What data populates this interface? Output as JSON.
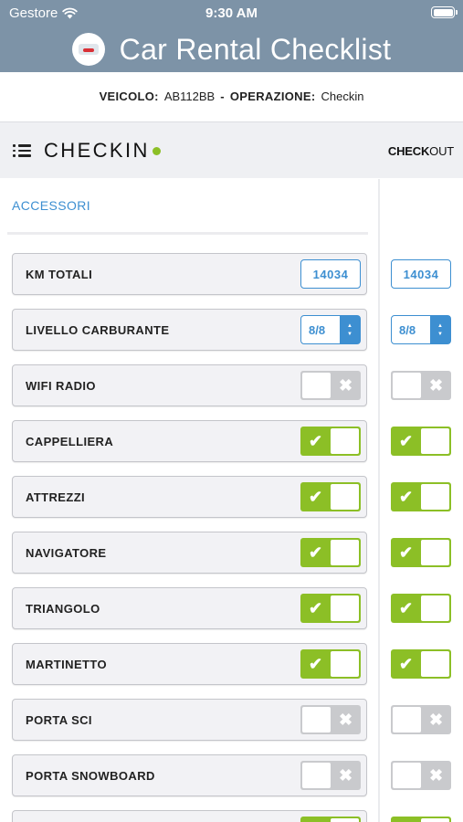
{
  "status_bar": {
    "carrier": "Gestore",
    "time": "9:30 AM"
  },
  "app": {
    "title": "Car Rental Checklist"
  },
  "info": {
    "vehicle_label": "VEICOLO:",
    "vehicle_value": "AB112BB",
    "separator": "-",
    "operation_label": "OPERAZIONE:",
    "operation_value": "Checkin"
  },
  "tabs": {
    "checkin": "CHECKIN",
    "checkout_bold": "CHECK",
    "checkout_rest": "OUT"
  },
  "section": {
    "title": "ACCESSORI"
  },
  "items": [
    {
      "label": "KM TOTALI",
      "type": "number",
      "checkin": "14034",
      "checkout": "14034"
    },
    {
      "label": "LIVELLO CARBURANTE",
      "type": "select",
      "checkin": "8/8",
      "checkout": "8/8"
    },
    {
      "label": "WIFI RADIO",
      "type": "toggle",
      "checkin": false,
      "checkout": false
    },
    {
      "label": "CAPPELLIERA",
      "type": "toggle",
      "checkin": true,
      "checkout": true
    },
    {
      "label": "ATTREZZI",
      "type": "toggle",
      "checkin": true,
      "checkout": true
    },
    {
      "label": "NAVIGATORE",
      "type": "toggle",
      "checkin": true,
      "checkout": true
    },
    {
      "label": "TRIANGOLO",
      "type": "toggle",
      "checkin": true,
      "checkout": true
    },
    {
      "label": "MARTINETTO",
      "type": "toggle",
      "checkin": true,
      "checkout": true
    },
    {
      "label": "PORTA SCI",
      "type": "toggle",
      "checkin": false,
      "checkout": false
    },
    {
      "label": "PORTA SNOWBOARD",
      "type": "toggle",
      "checkin": false,
      "checkout": false
    },
    {
      "label": "",
      "type": "toggle",
      "checkin": true,
      "checkout": true
    }
  ],
  "colors": {
    "header": "#7d93a7",
    "accent_blue": "#3d8fd1",
    "toggle_on": "#8cbf26",
    "toggle_off": "#c9cacd"
  },
  "icons": {
    "check": "✔",
    "cross": "✖",
    "up": "▲",
    "down": "▼"
  }
}
